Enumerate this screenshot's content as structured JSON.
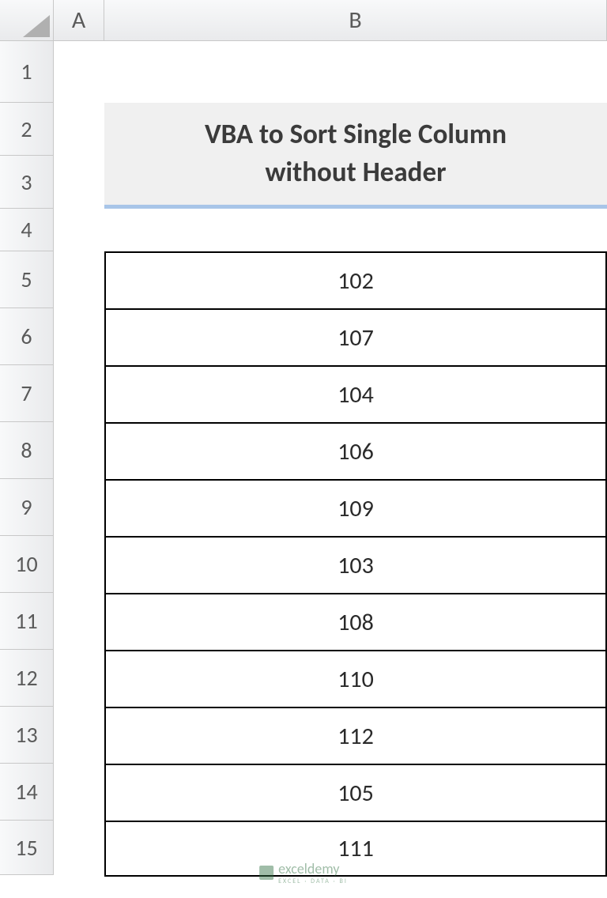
{
  "columns": {
    "A": "A",
    "B": "B"
  },
  "rows": [
    "1",
    "2",
    "3",
    "4",
    "5",
    "6",
    "7",
    "8",
    "9",
    "10",
    "11",
    "12",
    "13",
    "14",
    "15"
  ],
  "title_line1": "VBA to Sort Single Column",
  "title_line2": "without Header",
  "data": [
    "102",
    "107",
    "104",
    "106",
    "109",
    "103",
    "108",
    "110",
    "112",
    "105",
    "111"
  ],
  "watermark": {
    "brand": "exceldemy",
    "tagline": "EXCEL · DATA · BI"
  }
}
